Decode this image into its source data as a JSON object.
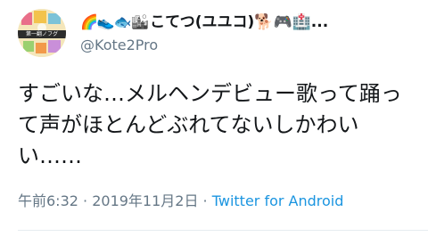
{
  "author": {
    "avatar_caption": "第一翻ノフグ",
    "display_name_emojis": "🌈👟🐟🏙",
    "display_name": "こてつ(ユユコ)🐕🎮🏥...",
    "handle": "@Kote2Pro"
  },
  "tweet": {
    "text": "すごいな…メルヘンデビュー歌って踊って声がほとんどぶれてないしかわいい……",
    "time": "午前6:32",
    "separator": " · ",
    "date": "2019年11月2日",
    "source": "Twitter for Android"
  },
  "colors": {
    "text": "#14171a",
    "secondary": "#657786",
    "link": "#1b95e0"
  }
}
